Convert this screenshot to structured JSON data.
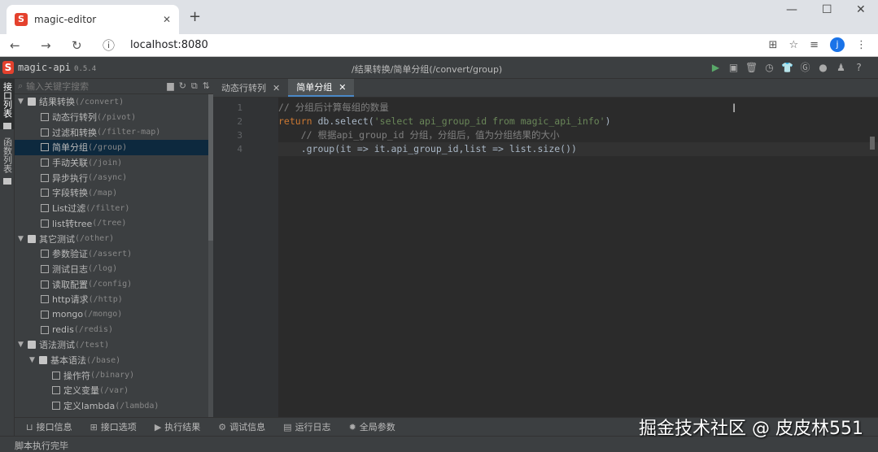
{
  "browser": {
    "tab_title": "magic-editor",
    "url": "localhost:8080",
    "avatar": "j"
  },
  "app": {
    "name": "magic-api",
    "version": "0.5.4",
    "breadcrumb": "/结果转换/简单分组(/convert/group)",
    "toolbar": [
      "run-icon",
      "save-icon",
      "delete-icon",
      "history-icon",
      "skin-icon",
      "gitee-icon",
      "github-icon",
      "qq-icon",
      "help-icon"
    ]
  },
  "left_strip": [
    {
      "label": "接口列表",
      "active": true
    },
    {
      "label": "函数列表",
      "active": false
    }
  ],
  "search": {
    "placeholder": "输入关键字搜索"
  },
  "tree": [
    {
      "level": 0,
      "type": "folder",
      "name": "结果转换",
      "path": "(/convert)"
    },
    {
      "level": 1,
      "type": "file",
      "name": "动态行转列",
      "path": "(/pivot)"
    },
    {
      "level": 1,
      "type": "file",
      "name": "过滤和转换",
      "path": "(/filter-map)"
    },
    {
      "level": 1,
      "type": "file",
      "name": "简单分组",
      "path": "(/group)",
      "selected": true
    },
    {
      "level": 1,
      "type": "file",
      "name": "手动关联",
      "path": "(/join)"
    },
    {
      "level": 1,
      "type": "file",
      "name": "异步执行",
      "path": "(/async)"
    },
    {
      "level": 1,
      "type": "file",
      "name": "字段转换",
      "path": "(/map)"
    },
    {
      "level": 1,
      "type": "file",
      "name": "List过滤",
      "path": "(/filter)"
    },
    {
      "level": 1,
      "type": "file",
      "name": "list转tree",
      "path": "(/tree)"
    },
    {
      "level": 0,
      "type": "folder",
      "name": "其它测试",
      "path": "(/other)"
    },
    {
      "level": 1,
      "type": "file",
      "name": "参数验证",
      "path": "(/assert)"
    },
    {
      "level": 1,
      "type": "file",
      "name": "测试日志",
      "path": "(/log)"
    },
    {
      "level": 1,
      "type": "file",
      "name": "读取配置",
      "path": "(/config)"
    },
    {
      "level": 1,
      "type": "file",
      "name": "http请求",
      "path": "(/http)"
    },
    {
      "level": 1,
      "type": "file",
      "name": "mongo",
      "path": "(/mongo)"
    },
    {
      "level": 1,
      "type": "file",
      "name": "redis",
      "path": "(/redis)"
    },
    {
      "level": 0,
      "type": "folder",
      "name": "语法测试",
      "path": "(/test)"
    },
    {
      "level": 1,
      "type": "folder",
      "name": "基本语法",
      "path": "(/base)"
    },
    {
      "level": 2,
      "type": "file",
      "name": "操作符",
      "path": "(/binary)"
    },
    {
      "level": 2,
      "type": "file",
      "name": "定义变量",
      "path": "(/var)"
    },
    {
      "level": 2,
      "type": "file",
      "name": "定义lambda",
      "path": "(/lambda)"
    }
  ],
  "editor_tabs": [
    {
      "label": "动态行转列",
      "active": false
    },
    {
      "label": "简单分组",
      "active": true
    }
  ],
  "code": {
    "line_numbers": [
      "1",
      "2",
      "3",
      "4"
    ],
    "l1": "// 分组后计算每组的数量",
    "l2_kw": "return",
    "l2_a": " db.select(",
    "l2_str": "'select api_group_id from magic_api_info'",
    "l2_b": ")",
    "l3": "    // 根据api_group_id 分组，分组后，值为分组结果的大小",
    "l4": "    .group(it => it.api_group_id,list => list.size())"
  },
  "bottom_tabs": [
    {
      "icon": "info-icon",
      "label": "接口信息"
    },
    {
      "icon": "options-icon",
      "label": "接口选项"
    },
    {
      "icon": "play-icon",
      "label": "执行结果"
    },
    {
      "icon": "bug-icon",
      "label": "调试信息"
    },
    {
      "icon": "log-icon",
      "label": "运行日志"
    },
    {
      "icon": "gear-icon",
      "label": "全局参数"
    }
  ],
  "status": "脚本执行完毕",
  "watermark": "掘金技术社区 @ 皮皮林551"
}
